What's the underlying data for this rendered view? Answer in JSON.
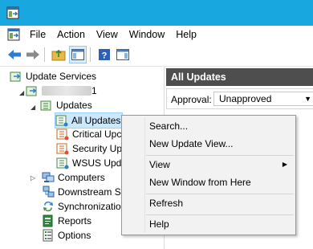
{
  "menubar": {
    "items": [
      "File",
      "Action",
      "View",
      "Window",
      "Help"
    ]
  },
  "tree": {
    "root": "Update Services",
    "server": "1",
    "updates": "Updates",
    "all_updates": "All Updates",
    "critical_updates": "Critical Upc",
    "security_updates": "Security Up",
    "wsus_updates": "WSUS Upda",
    "computers": "Computers",
    "downstream": "Downstream Se",
    "synchronizations": "Synchronization",
    "reports": "Reports",
    "options": "Options"
  },
  "right_pane": {
    "header": "All Updates",
    "approval_label": "Approval:",
    "approval_value": "Unapproved"
  },
  "context_menu": {
    "search": "Search...",
    "new_update_view": "New Update View...",
    "view": "View",
    "new_window": "New Window from Here",
    "refresh": "Refresh",
    "help": "Help"
  },
  "colors": {
    "titlebar": "#19a7e0",
    "pane_header": "#4e4e4e",
    "selection": "#cce8ff",
    "menu_bg": "#f2f2f2"
  }
}
